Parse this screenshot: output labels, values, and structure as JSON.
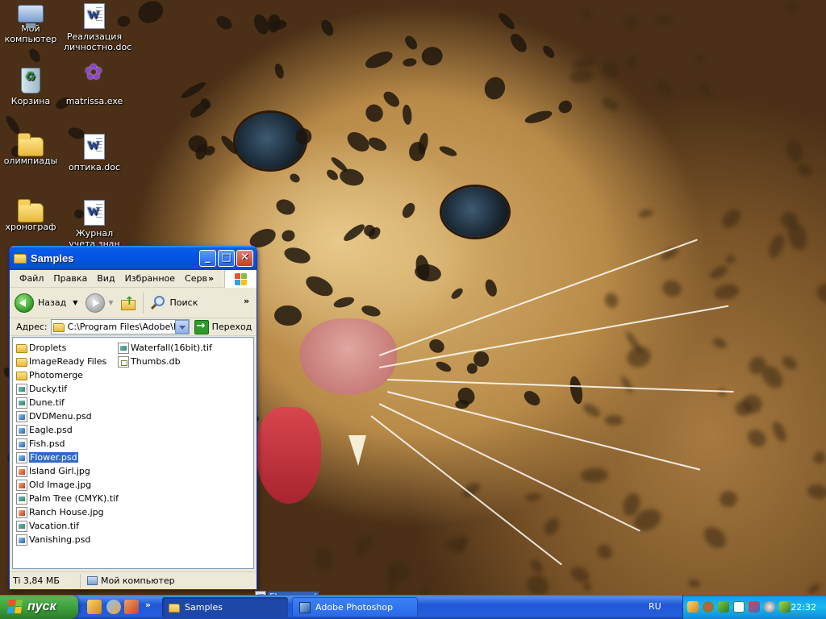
{
  "desktop": {
    "icons": [
      {
        "label": "Мой\nкомпьютер",
        "icon": "computer-icon"
      },
      {
        "label": "Реализация\nличностно.doc",
        "icon": "word-document-icon"
      },
      {
        "label": "Корзина",
        "icon": "recycle-bin-icon"
      },
      {
        "label": "matrissa.exe",
        "icon": "program-shortcut-icon"
      },
      {
        "label": "олимпиады",
        "icon": "folder-icon"
      },
      {
        "label": "оптика.doc",
        "icon": "word-document-icon"
      },
      {
        "label": "хронограф",
        "icon": "folder-icon"
      },
      {
        "label": "Журнал\nучета знан",
        "icon": "word-document-icon"
      }
    ]
  },
  "window": {
    "title": "Samples",
    "menu": [
      "Файл",
      "Правка",
      "Вид",
      "Избранное",
      "Серв"
    ],
    "menu_overflow": "»",
    "toolbar": {
      "back_label": "Назад",
      "search_label": "Поиск",
      "overflow": "»"
    },
    "address": {
      "label": "Адрес:",
      "value": "C:\\Program Files\\Adobe\\Ph",
      "go_label": "Переход"
    },
    "files_col1": [
      {
        "name": "Droplets",
        "type": "folder"
      },
      {
        "name": "ImageReady Files",
        "type": "folder"
      },
      {
        "name": "Photomerge",
        "type": "folder"
      },
      {
        "name": "Ducky.tif",
        "type": "tif"
      },
      {
        "name": "Dune.tif",
        "type": "tif"
      },
      {
        "name": "DVDMenu.psd",
        "type": "psd"
      },
      {
        "name": "Eagle.psd",
        "type": "psd"
      },
      {
        "name": "Fish.psd",
        "type": "psd"
      },
      {
        "name": "Flower.psd",
        "type": "psd",
        "selected": true
      },
      {
        "name": "Island Girl.jpg",
        "type": "jpg"
      },
      {
        "name": "Old Image.jpg",
        "type": "jpg"
      },
      {
        "name": "Palm Tree (CMYK).tif",
        "type": "tif"
      },
      {
        "name": "Ranch House.jpg",
        "type": "jpg"
      },
      {
        "name": "Vacation.tif",
        "type": "tif"
      },
      {
        "name": "Vanishing.psd",
        "type": "psd"
      }
    ],
    "files_col2": [
      {
        "name": "Waterfall(16bit).tif",
        "type": "tif"
      },
      {
        "name": "Thumbs.db",
        "type": "db"
      }
    ],
    "status": {
      "size": "Ti 3,84 МБ",
      "location": "Мой компьютер"
    }
  },
  "drag_ghost": {
    "name": "Flower.psd"
  },
  "taskbar": {
    "start_label": "пуск",
    "tasks": [
      {
        "label": "Samples",
        "active": true
      },
      {
        "label": "Adobe Photoshop",
        "active": false
      }
    ],
    "language": "RU",
    "clock": "22:32"
  },
  "colors": {
    "titlebar": "#0054e3",
    "selection": "#316ac5",
    "taskbar": "#245edb",
    "start": "#3a9b38"
  }
}
